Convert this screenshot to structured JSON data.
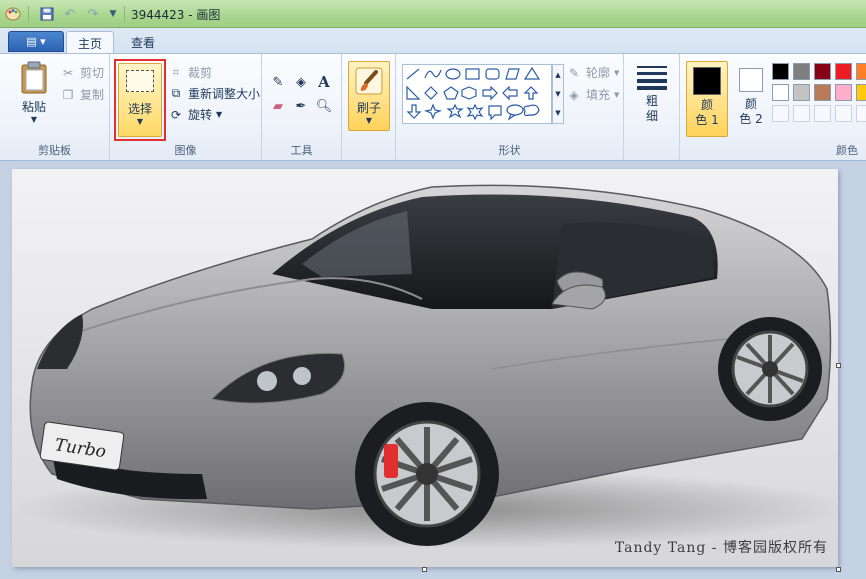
{
  "window": {
    "title": "3944423 - 画图",
    "app_icon": "paint-palette-icon"
  },
  "quick_access": {
    "save": "save-icon",
    "undo": "undo-icon",
    "redo": "redo-icon",
    "customize": "chevron-down-icon"
  },
  "tabs": [
    {
      "label": "主页",
      "active": true
    },
    {
      "label": "查看",
      "active": false
    }
  ],
  "ribbon": {
    "clipboard": {
      "group_label": "剪贴板",
      "paste_label": "粘贴",
      "cut_label": "剪切",
      "copy_label": "复制"
    },
    "image": {
      "group_label": "图像",
      "select_label": "选择",
      "crop_label": "裁剪",
      "resize_label": "重新调整大小",
      "rotate_label": "旋转"
    },
    "tools": {
      "group_label": "工具",
      "items": [
        "pencil-icon",
        "fill-icon",
        "text-icon",
        "eraser-icon",
        "color-picker-icon",
        "magnifier-icon"
      ]
    },
    "brushes": {
      "label": "刷子"
    },
    "shapes": {
      "group_label": "形状",
      "outline_label": "轮廓",
      "fill_label": "填充"
    },
    "size": {
      "label_line1": "粗",
      "label_line2": "细"
    },
    "colors": {
      "group_label": "颜色",
      "color1_line1": "颜",
      "color1_line2": "色 1",
      "color2_line1": "颜",
      "color2_line2": "色 2",
      "color1_value": "#000000",
      "color2_value": "#ffffff",
      "palette_row1": [
        "#000000",
        "#7f7f7f",
        "#880015",
        "#ed1c24",
        "#ff7f27"
      ],
      "palette_row2": [
        "#ffffff",
        "#c3c3c3",
        "#b97a57",
        "#ffaec9",
        "#ffc90e"
      ]
    }
  },
  "canvas": {
    "watermark": "Tandy Tang - 博客园版权所有",
    "badge_text": "Turbo",
    "highlight_color": "#e03030"
  }
}
